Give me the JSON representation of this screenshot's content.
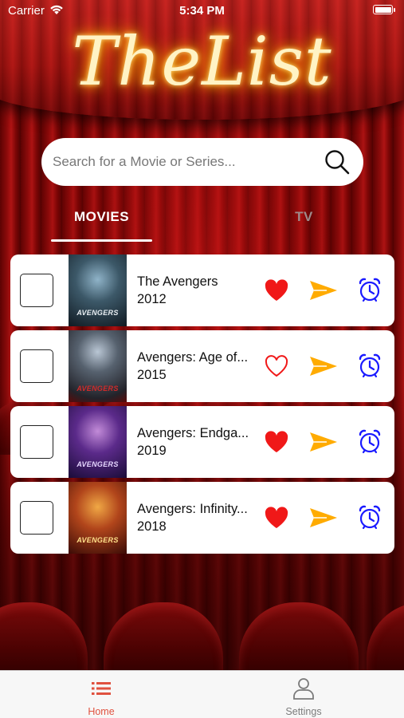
{
  "status_bar": {
    "carrier": "Carrier",
    "time": "5:34 PM"
  },
  "logo": {
    "text": "TheList"
  },
  "search": {
    "placeholder": "Search for a Movie or Series..."
  },
  "tabs": [
    {
      "label": "MOVIES",
      "active": true
    },
    {
      "label": "TV",
      "active": false
    }
  ],
  "movies": [
    {
      "title": "The Avengers",
      "year": "2012",
      "favorite": true,
      "poster_title": "AVENGERS"
    },
    {
      "title": "Avengers: Age of...",
      "year": "2015",
      "favorite": false,
      "poster_title": "AVENGERS"
    },
    {
      "title": "Avengers: Endga...",
      "year": "2019",
      "favorite": true,
      "poster_title": "AVENGERS"
    },
    {
      "title": "Avengers: Infinity...",
      "year": "2018",
      "favorite": true,
      "poster_title": "AVENGERS"
    }
  ],
  "tabbar": {
    "home_label": "Home",
    "settings_label": "Settings"
  },
  "colors": {
    "accent": "#e0513f",
    "heart": "#f01818",
    "send": "#ffab00",
    "clock": "#1a1aff"
  },
  "icons": [
    "wifi-icon",
    "battery-icon",
    "search-icon",
    "heart-icon",
    "send-icon",
    "alarm-clock-icon",
    "list-icon",
    "person-icon"
  ]
}
